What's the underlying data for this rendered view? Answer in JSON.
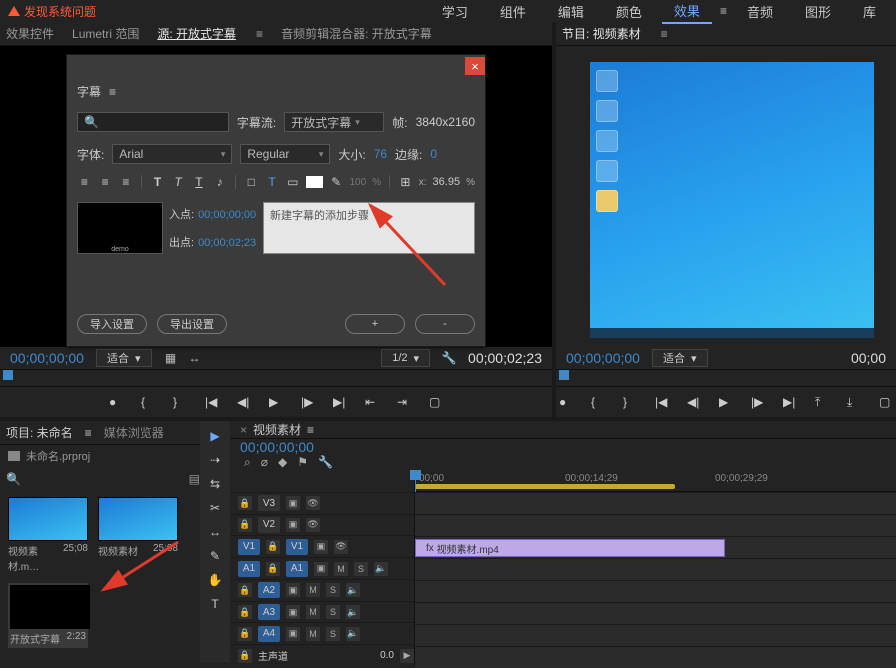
{
  "menubar": {
    "warn": "发现系统问题",
    "tabs": [
      "学习",
      "组件",
      "编辑",
      "颜色",
      "效果",
      "音频",
      "图形",
      "库"
    ],
    "active": "效果"
  },
  "source_panel": {
    "tabs": [
      "效果控件",
      "Lumetri 范围",
      "源: 开放式字幕",
      "音频剪辑混合器: 开放式字幕"
    ],
    "active": 2,
    "timecode_left": "00;00;00;00",
    "timecode_right": "00;00;02;23",
    "fit": "适合",
    "scale": "1/2"
  },
  "caption_dlg": {
    "title": "字幕",
    "stream_label": "字幕流:",
    "stream_value": "开放式字幕",
    "frame_label": "帧:",
    "frame_value": "3840x2160",
    "font_label": "字体:",
    "font_value": "Arial",
    "weight_value": "Regular",
    "size_label": "大小:",
    "size_value": "76",
    "edge_label": "边缘:",
    "edge_value": "0",
    "opacity_value": "100",
    "pct": "%",
    "x_label": "x:",
    "x_value": "36.95",
    "in_label": "入点:",
    "in_tc": "00;00;00;00",
    "out_label": "出点:",
    "out_tc": "00;00;02;23",
    "caption_text": "新建字幕的添加步骤",
    "import_btn": "导入设置",
    "export_btn": "导出设置",
    "plus_btn": "+",
    "minus_btn": "-"
  },
  "program_panel": {
    "title": "节目: 视频素材",
    "timecode_left": "00;00;00;00",
    "timecode_right": "00;00",
    "fit": "适合"
  },
  "project_panel": {
    "tabs": [
      "项目: 未命名",
      "媒体浏览器"
    ],
    "proj_name": "未命名.prproj",
    "items": [
      {
        "name": "视频素材.m…",
        "dur": "25;08",
        "type": "blue"
      },
      {
        "name": "视频素材",
        "dur": "25;08",
        "type": "blue"
      },
      {
        "name": "开放式字幕",
        "dur": "2:23",
        "type": "black"
      }
    ]
  },
  "timeline": {
    "title": "视频素材",
    "tc": "00;00;00;00",
    "ruler": [
      "00;00",
      "00;00;14;29",
      "00;00;29;29"
    ],
    "video_tracks": [
      "V3",
      "V2",
      "V1"
    ],
    "audio_tracks": [
      "A1",
      "A2",
      "A3",
      "A4"
    ],
    "master_label": "主声道",
    "mute": "M",
    "solo": "S",
    "clip_name": "视频素材.mp4",
    "meter_zero": "0.0"
  }
}
